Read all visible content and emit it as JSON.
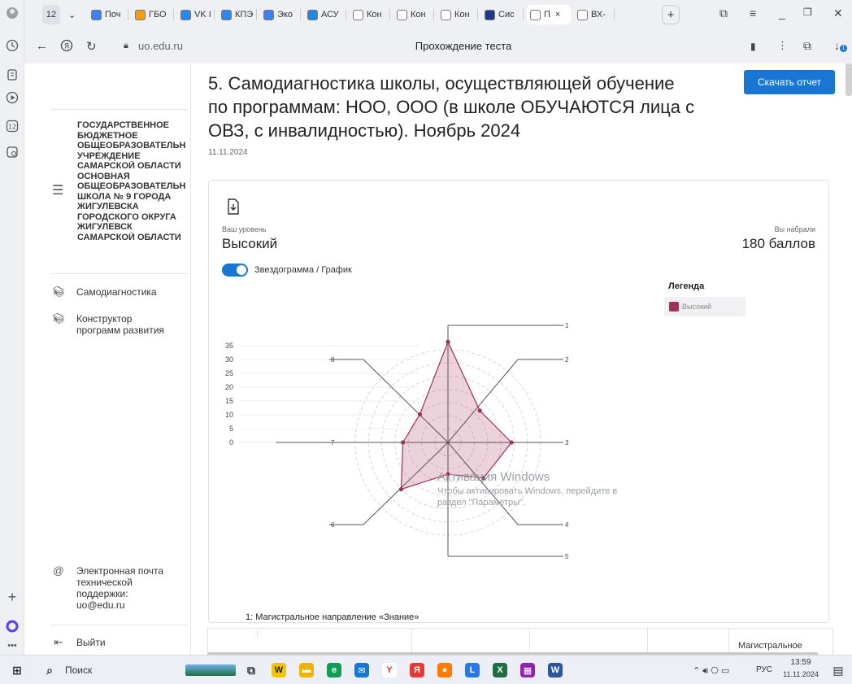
{
  "browser": {
    "tab_count_badge": "12",
    "tabs": [
      {
        "label": "Поч",
        "color": "#3b82f6"
      },
      {
        "label": "ГБО",
        "color": "#f59e0b"
      },
      {
        "label": "VK I",
        "color": "#2787f5"
      },
      {
        "label": "КПЭ",
        "color": "#2787f5"
      },
      {
        "label": "Эко",
        "color": "#3b82f6"
      },
      {
        "label": "АСУ",
        "color": "#1e88e5"
      },
      {
        "label": "Кон",
        "color": "#ffffff"
      },
      {
        "label": "Кон",
        "color": "#ffffff"
      },
      {
        "label": "Кон",
        "color": "#ffffff"
      },
      {
        "label": "Сис",
        "color": "#1e3a8a"
      },
      {
        "label": "П",
        "color": "#ffffff"
      },
      {
        "label": "ВХ-",
        "color": "#ffffff"
      }
    ],
    "new_tab": "+",
    "url": "uo.edu.ru",
    "page_title": "Прохождение теста",
    "download_badge": "1"
  },
  "sidebar": {
    "org_lines": [
      "ГОСУДАРСТВЕННОЕ",
      "БЮДЖЕТНОЕ",
      "ОБЩЕОБРАЗОВАТЕЛЬН",
      "УЧРЕЖДЕНИЕ",
      "САМАРСКОЙ ОБЛАСТИ",
      "ОСНОВНАЯ",
      "ОБЩЕОБРАЗОВАТЕЛЬН",
      "ШКОЛА № 9 ГОРОДА",
      "ЖИГУЛЕВСКА",
      "ГОРОДСКОГО ОКРУГА",
      "ЖИГУЛЕВСК",
      "САМАРСКОЙ ОБЛАСТИ"
    ],
    "nav": [
      {
        "label_lines": [
          "Самодиагностика"
        ]
      },
      {
        "label_lines": [
          "Конструктор",
          "программ развития"
        ]
      }
    ],
    "support_lines": [
      "Электронная почта",
      "технической",
      "поддержки:",
      "uo@edu.ru"
    ],
    "logout": "Выйти"
  },
  "main": {
    "title_lines": [
      "5. Самодиагностика школы, осуществляющей обучение",
      "по программам: НОО, ООО (в школе ОБУЧАЮТСЯ лица с",
      "ОВЗ, с инвалидностью). Ноябрь 2024"
    ],
    "date": "11.11.2024",
    "download_button": "Скачать отчет",
    "level_label": "Ваш уровень",
    "level_value": "Высокий",
    "score_label": "Вы набрали",
    "score_value": "180 баллов",
    "toggle_label": "Звездограмма / График",
    "legend_title": "Легенда",
    "legend_item": "Высокий",
    "caption": "1: Магистральное направление «Знание»",
    "table_last_header": "Магистральное"
  },
  "chart_data": {
    "type": "radar",
    "axes": [
      "1",
      "2",
      "3",
      "4",
      "5",
      "6",
      "7",
      "8"
    ],
    "radial_ticks": [
      "0",
      "5",
      "10",
      "15",
      "20",
      "25",
      "30",
      "35"
    ],
    "rmax": 35,
    "series": [
      {
        "name": "Высокий",
        "color": "#a3305a",
        "values": [
          38,
          17,
          24,
          19,
          12,
          25,
          17,
          15
        ]
      }
    ]
  },
  "overlay": {
    "activation_title": "Активация Windows",
    "activation_lines": [
      "Чтобы активировать Windows, перейдите в",
      "раздел \"Параметры\"."
    ]
  },
  "taskbar": {
    "search": "Поиск",
    "lang": "РУС",
    "time": "13:59",
    "date": "11.11.2024"
  },
  "colors": {
    "accent": "#1976d2",
    "series": "#a3305a"
  }
}
